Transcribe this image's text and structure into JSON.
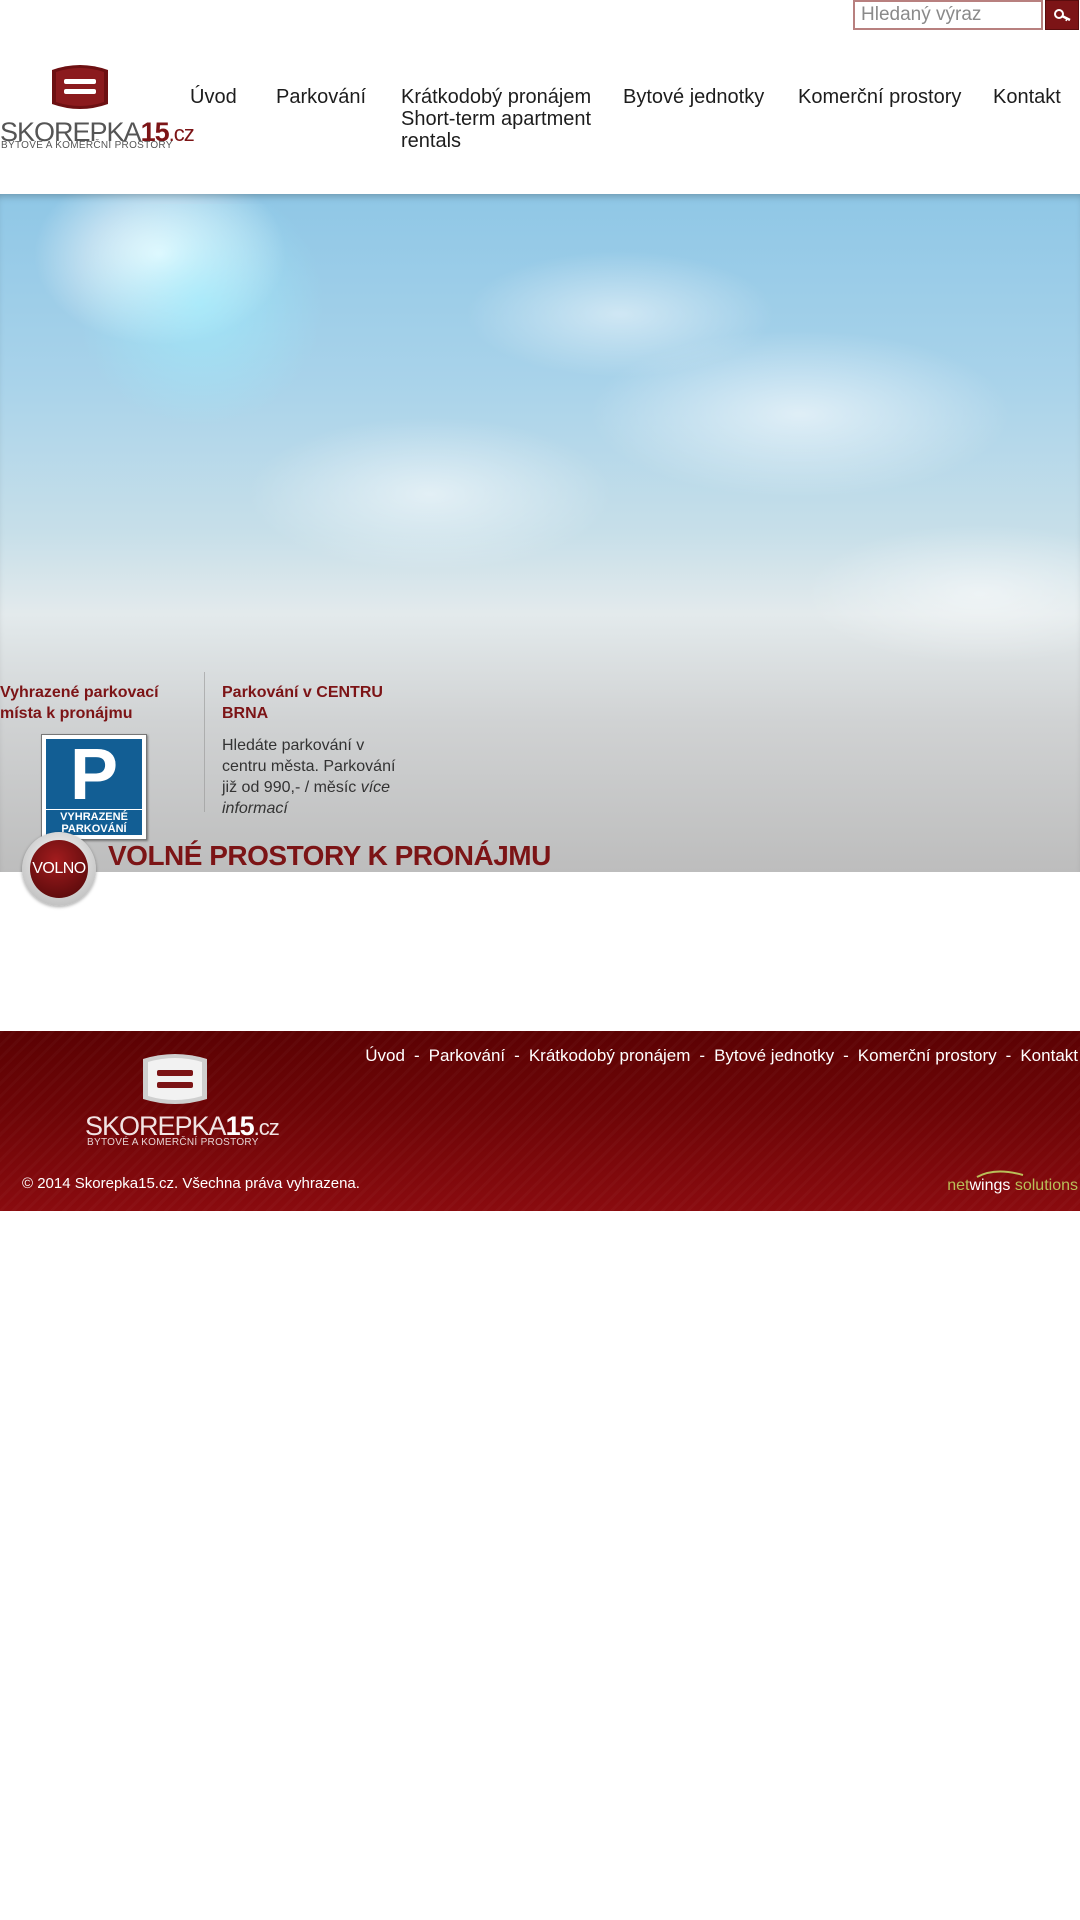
{
  "search": {
    "placeholder": "Hledaný výraz"
  },
  "logo": {
    "name": "SKOREPKA",
    "num": "15",
    "tld": ".cz",
    "subtitle": "BYTOVÉ A KOMERČNÍ PROSTORY"
  },
  "nav": {
    "items": [
      {
        "label": "Úvod"
      },
      {
        "label": "Parkování"
      },
      {
        "label": "Krátkodobý pronájem",
        "sub1": "Short-term apartment",
        "sub2": "rentals"
      },
      {
        "label": "Bytové jednotky"
      },
      {
        "label": "Komerční prostory"
      },
      {
        "label": "Kontakt"
      }
    ]
  },
  "info": {
    "parking_heading": "Vyhrazené parkovací místa k pronájmu",
    "sign_letter": "P",
    "sign_line1": "VYHRAZENÉ",
    "sign_line2": "PARKOVÁNÍ",
    "center_heading": "Parkování v CENTRU BRNA",
    "center_text": "Hledáte parkování v centru města. Parkování již od 990,- / měsíc",
    "center_more": "více informací"
  },
  "volno": {
    "badge": "VOLNO",
    "title": "VOLNÉ PROSTORY K PRONÁJMU"
  },
  "footer": {
    "nav": [
      "Úvod",
      "Parkování",
      "Krátkodobý pronájem",
      "Bytové jednotky",
      "Komerční prostory",
      "Kontakt"
    ],
    "separator": "-",
    "copyright": "© 2014 Skorepka15.cz. Všechna práva vyhrazena.",
    "credit_a": "net",
    "credit_b": "wings",
    "credit_c": " solutions"
  },
  "colors": {
    "brand": "#7c1416",
    "footer_bg": "#6e0507",
    "sign_blue": "#125e94",
    "credit_green": "#b9bf59"
  }
}
